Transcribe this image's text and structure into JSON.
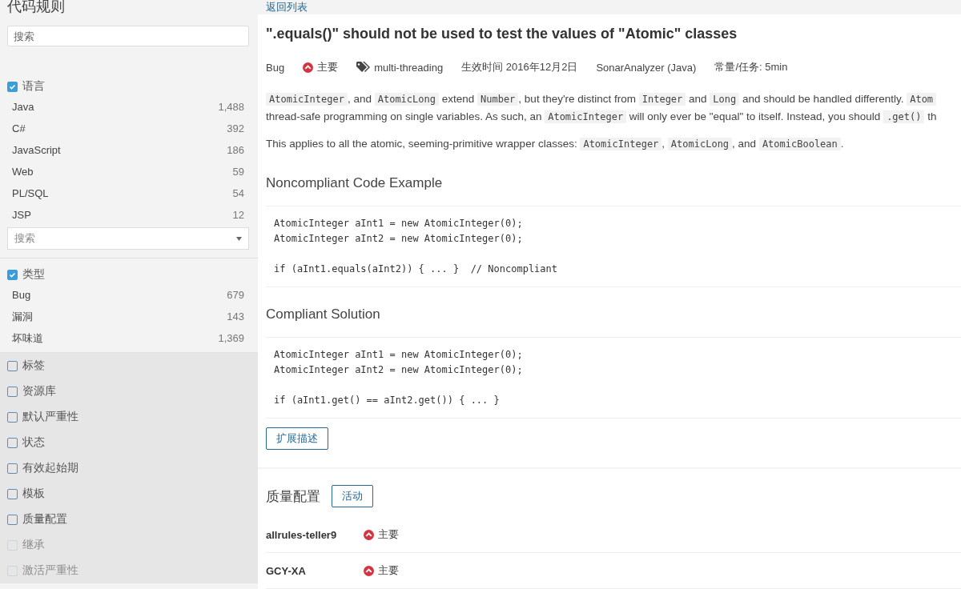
{
  "sidebar": {
    "title": "代码规则",
    "search": {
      "placeholder": "搜索"
    },
    "facets": [
      {
        "label": "语言",
        "checked": true,
        "disabled": false,
        "items": [
          {
            "label": "Java",
            "count": "1,488"
          },
          {
            "label": "C#",
            "count": "392"
          },
          {
            "label": "JavaScript",
            "count": "186"
          },
          {
            "label": "Web",
            "count": "59"
          },
          {
            "label": "PL/SQL",
            "count": "54"
          },
          {
            "label": "JSP",
            "count": "12"
          }
        ],
        "select": {
          "placeholder": "搜索"
        }
      },
      {
        "label": "类型",
        "checked": true,
        "disabled": false,
        "items": [
          {
            "label": "Bug",
            "count": "679"
          },
          {
            "label": "漏洞",
            "count": "143"
          },
          {
            "label": "坏味道",
            "count": "1,369"
          }
        ]
      },
      {
        "label": "标签",
        "checked": false,
        "disabled": false
      },
      {
        "label": "资源库",
        "checked": false,
        "disabled": false
      },
      {
        "label": "默认严重性",
        "checked": false,
        "disabled": false
      },
      {
        "label": "状态",
        "checked": false,
        "disabled": false
      },
      {
        "label": "有效起始期",
        "checked": false,
        "disabled": false
      },
      {
        "label": "模板",
        "checked": false,
        "disabled": false
      },
      {
        "label": "质量配置",
        "checked": false,
        "disabled": false
      },
      {
        "label": "继承",
        "checked": false,
        "disabled": true
      },
      {
        "label": "激活严重性",
        "checked": false,
        "disabled": true
      }
    ]
  },
  "back_link": "返回列表",
  "rule": {
    "title": "\".equals()\" should not be used to test the values of \"Atomic\" classes",
    "meta": [
      {
        "kind": "text",
        "text": "Bug"
      },
      {
        "kind": "severity",
        "text": "主要"
      },
      {
        "kind": "tag",
        "text": "multi-threading"
      },
      {
        "kind": "text",
        "text": "生效时间 2016年12月2日"
      },
      {
        "kind": "text",
        "text": "SonarAnalyzer (Java)"
      },
      {
        "kind": "text",
        "text": "常量/任务: 5min"
      }
    ],
    "paragraphs": [
      {
        "lines": [
          [
            {
              "code": true,
              "text": "AtomicInteger"
            },
            {
              "code": false,
              "text": ", and "
            },
            {
              "code": true,
              "text": "AtomicLong"
            },
            {
              "code": false,
              "text": " extend "
            },
            {
              "code": true,
              "text": "Number"
            },
            {
              "code": false,
              "text": ", but they're distinct from "
            },
            {
              "code": true,
              "text": "Integer"
            },
            {
              "code": false,
              "text": " and "
            },
            {
              "code": true,
              "text": "Long"
            },
            {
              "code": false,
              "text": " and should be handled differently. "
            },
            {
              "code": true,
              "text": "Atom"
            }
          ],
          [
            {
              "code": false,
              "text": "thread-safe programming on single variables. As such, an "
            },
            {
              "code": true,
              "text": "AtomicInteger"
            },
            {
              "code": false,
              "text": " will only ever be \"equal\" to itself. Instead, you should "
            },
            {
              "code": true,
              "text": ".get()"
            },
            {
              "code": false,
              "text": " th"
            }
          ]
        ]
      },
      {
        "lines": [
          [
            {
              "code": false,
              "text": "This applies to all the atomic, seeming-primitive wrapper classes: "
            },
            {
              "code": true,
              "text": "AtomicInteger"
            },
            {
              "code": false,
              "text": ", "
            },
            {
              "code": true,
              "text": "AtomicLong"
            },
            {
              "code": false,
              "text": ", and "
            },
            {
              "code": true,
              "text": "AtomicBoolean"
            },
            {
              "code": false,
              "text": "."
            }
          ]
        ]
      }
    ],
    "sections": [
      {
        "heading": "Noncompliant Code Example",
        "code": [
          [
            "AtomicInteger aInt1 = new AtomicInteger(0);",
            "AtomicInteger aInt2 = new AtomicInteger(0);"
          ],
          [
            "if (aInt1.equals(aInt2)) { ... }  // Noncompliant"
          ]
        ]
      },
      {
        "heading": "Compliant Solution",
        "code": [
          [
            "AtomicInteger aInt1 = new AtomicInteger(0);",
            "AtomicInteger aInt2 = new AtomicInteger(0);"
          ],
          [
            "if (aInt1.get() == aInt2.get()) { ... }"
          ]
        ]
      }
    ],
    "extend_button": "扩展描述"
  },
  "quality_profiles": {
    "title": "质量配置",
    "button": "活动",
    "rows": [
      {
        "name": "allrules-teller9",
        "severity": "主要"
      },
      {
        "name": "GCY-XA",
        "severity": "主要"
      }
    ]
  }
}
